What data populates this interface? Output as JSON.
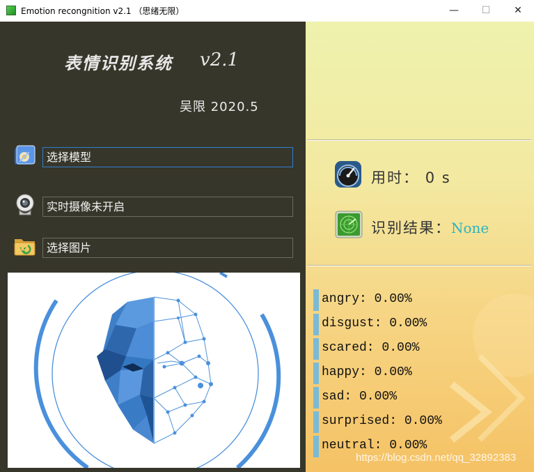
{
  "window": {
    "title": "Emotion recongnition v2.1  （思绪无限）",
    "minimize_glyph": "—",
    "maximize_glyph": "☐",
    "close_glyph": "✕"
  },
  "header": {
    "title": "表情识别系统",
    "version": "v2.1",
    "author": "吴限 2020.5"
  },
  "actions": [
    {
      "label": "选择模型",
      "icon": "folder-model-icon"
    },
    {
      "label": "实时摄像未开启",
      "icon": "webcam-icon"
    },
    {
      "label": "选择图片",
      "icon": "folder-image-icon"
    }
  ],
  "stats": {
    "time_label": "用时：",
    "time_value": "0 s",
    "result_label": "识别结果：",
    "result_value": "None"
  },
  "emotions": [
    {
      "name": "angry",
      "text": "angry: 0.00%"
    },
    {
      "name": "disgust",
      "text": "disgust: 0.00%"
    },
    {
      "name": "scared",
      "text": "scared: 0.00%"
    },
    {
      "name": "happy",
      "text": "happy: 0.00%"
    },
    {
      "name": "sad",
      "text": "sad: 0.00%"
    },
    {
      "name": "surprised",
      "text": "surprised: 0.00%"
    },
    {
      "name": "neutral",
      "text": "neutral: 0.00%"
    }
  ],
  "watermark": "https://blog.csdn.net/qq_32892383",
  "colors": {
    "left_panel_bg": "#37362a",
    "accent_blue": "#2f7fd0",
    "result_teal": "#2bb3c0",
    "emotion_bar": "#7bbad5"
  }
}
